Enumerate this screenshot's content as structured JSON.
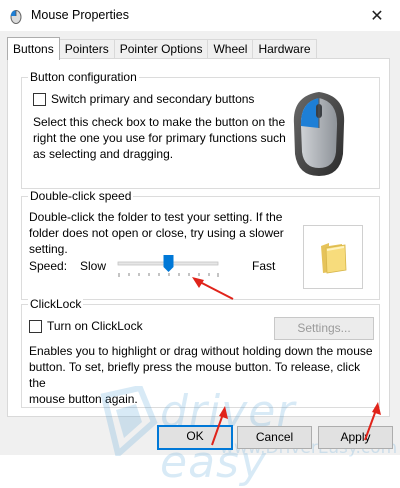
{
  "window": {
    "title": "Mouse Properties",
    "close_glyph": "✕"
  },
  "tabs": [
    {
      "label": "Buttons",
      "active": true
    },
    {
      "label": "Pointers",
      "active": false
    },
    {
      "label": "Pointer Options",
      "active": false
    },
    {
      "label": "Wheel",
      "active": false
    },
    {
      "label": "Hardware",
      "active": false
    }
  ],
  "button_config": {
    "legend": "Button configuration",
    "checkbox_label": "Switch primary and secondary buttons",
    "checked": false,
    "description_lines": [
      "Select this check box to make the button on the",
      "right the one you use for primary functions such",
      "as selecting and dragging."
    ]
  },
  "double_click": {
    "legend": "Double-click speed",
    "description_lines": [
      "Double-click the folder to test your setting. If the",
      "folder does not open or close, try using a slower",
      "setting."
    ],
    "speed_label": "Speed:",
    "slow_label": "Slow",
    "fast_label": "Fast",
    "speed_level": 0.5
  },
  "clicklock": {
    "legend": "ClickLock",
    "checkbox_label": "Turn on ClickLock",
    "checked": false,
    "settings_label": "Settings...",
    "settings_enabled": false,
    "description_lines": [
      "Enables you to highlight or drag without holding down the mouse",
      "button. To set, briefly press the mouse button. To release, click the",
      "mouse button again."
    ]
  },
  "buttons": {
    "ok": "OK",
    "cancel": "Cancel",
    "apply": "Apply"
  },
  "watermark": {
    "text": "driver easy",
    "url": "www.DriverEasy.com"
  },
  "colors": {
    "accent": "#0078d7",
    "annotation": "#e0241b",
    "mouse_blue": "#1e7fd6"
  },
  "icons": {
    "app": "mouse-icon",
    "folder": "folder-icon",
    "mouse_image": "mouse-illustration"
  }
}
